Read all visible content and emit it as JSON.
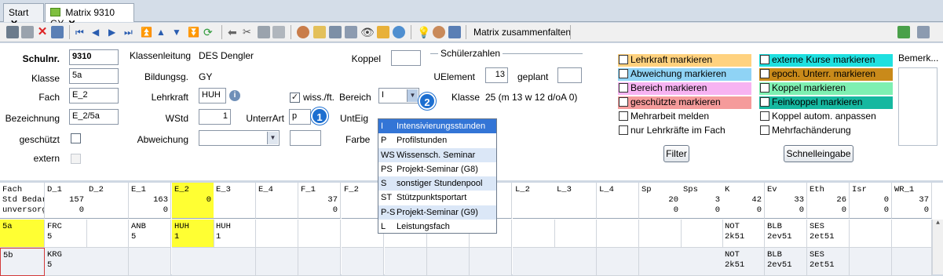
{
  "tabs": [
    {
      "label": "Start",
      "close": "✕"
    },
    {
      "label": "Matrix 9310 GY",
      "close": "✕"
    }
  ],
  "toolbar": {
    "collapse_label": "Matrix zusammenfalten"
  },
  "form": {
    "schulnr_label": "Schulnr.",
    "schulnr_value": "9310",
    "klasse_label": "Klasse",
    "klasse_value": "5a",
    "fach_label": "Fach",
    "fach_value": "E_2",
    "bezeichnung_label": "Bezeichnung",
    "bezeichnung_value": "E_2/5a",
    "geschuetzt_label": "geschützt",
    "extern_label": "extern",
    "klassenleitung_label": "Klassenleitung",
    "klassenleitung_value": "DES Dengler",
    "bildungsg_label": "Bildungsg.",
    "bildungsg_value": "GY",
    "lehrkraft_label": "Lehrkraft",
    "lehrkraft_value": "HUH",
    "wstd_label": "WStd",
    "wstd_value": "1",
    "abweichung_label": "Abweichung",
    "abweichung_value": "",
    "koppel_label": "Koppel",
    "koppel_value": "",
    "wiss_label": "wiss./ft.",
    "bereich_label": "Bereich",
    "bereich_value": "I",
    "unterrart_label": "UnterrArt",
    "unterrart_value": "p",
    "unteig_label": "UntEig",
    "farbe_label": "Farbe",
    "schuelerzahlen_label": "Schülerzahlen",
    "uelement_label": "UElement",
    "uelement_value": "13",
    "geplant_label": "geplant",
    "geplant_value": "",
    "klasse2_label": "Klasse",
    "klasse2_value": "25 (m 13 w 12 d/oA 0)",
    "bemerk_label": "Bemerk..."
  },
  "markers_left": [
    {
      "label": "Lehrkraft markieren",
      "color": "#ffd27f"
    },
    {
      "label": "Abweichung markieren",
      "color": "#8fd3f5"
    },
    {
      "label": "Bereich markieren",
      "color": "#f7b3f2"
    },
    {
      "label": "geschützte markieren",
      "color": "#f59b9b"
    },
    {
      "label": "Mehrarbeit melden",
      "color": ""
    },
    {
      "label": "nur Lehrkräfte im Fach",
      "color": ""
    }
  ],
  "markers_right": [
    {
      "label": "externe Kurse markieren",
      "color": "#1fe0e0"
    },
    {
      "label": "epoch. Unterr. markieren",
      "color": "#c98a1a"
    },
    {
      "label": "Koppel markieren",
      "color": "#7ef0b2"
    },
    {
      "label": "Feinkoppel markieren",
      "color": "#16b8a0"
    },
    {
      "label": "Koppel autom. anpassen",
      "color": ""
    },
    {
      "label": "Mehrfachänderung",
      "color": ""
    }
  ],
  "buttons": {
    "filter": "Filter",
    "schnelleingabe": "Schnelleingabe"
  },
  "badges": {
    "one": "1",
    "two": "2"
  },
  "dropdown": {
    "items": [
      {
        "code": "I",
        "label": "Intensivierungsstunden"
      },
      {
        "code": "P",
        "label": "Profilstunden"
      },
      {
        "code": "WS",
        "label": "Wissensch. Seminar"
      },
      {
        "code": "PS",
        "label": "Projekt-Seminar (G8)"
      },
      {
        "code": "S",
        "label": "sonstiger Stundenpool"
      },
      {
        "code": "ST",
        "label": "Stützpunktsportart"
      },
      {
        "code": "P-S",
        "label": "Projekt-Seminar (G9)"
      },
      {
        "code": "L",
        "label": "Leistungsfach"
      }
    ]
  },
  "grid": {
    "corner": [
      "Fach",
      "Std Bedarf",
      "unversorgt"
    ],
    "columns": [
      {
        "name": "D_1",
        "bedarf": "157",
        "unv": "0"
      },
      {
        "name": "D_2",
        "bedarf": "",
        "unv": ""
      },
      {
        "name": "E_1",
        "bedarf": "163",
        "unv": "0"
      },
      {
        "name": "E_2",
        "bedarf": "",
        "unv": "0"
      },
      {
        "name": "E_3",
        "bedarf": "",
        "unv": ""
      },
      {
        "name": "E_4",
        "bedarf": "",
        "unv": ""
      },
      {
        "name": "F_1",
        "bedarf": "37",
        "unv": "0"
      },
      {
        "name": "F_2",
        "bedarf": "",
        "unv": ""
      },
      {
        "name": "",
        "bedarf": "",
        "unv": ""
      },
      {
        "name": "",
        "bedarf": "",
        "unv": ""
      },
      {
        "name": "",
        "bedarf": "",
        "unv": ""
      },
      {
        "name": "L_2",
        "bedarf": "",
        "unv": ""
      },
      {
        "name": "L_3",
        "bedarf": "",
        "unv": ""
      },
      {
        "name": "L_4",
        "bedarf": "",
        "unv": ""
      },
      {
        "name": "Sp",
        "bedarf": "20",
        "unv": "0"
      },
      {
        "name": "Sps",
        "bedarf": "3",
        "unv": "0"
      },
      {
        "name": "K",
        "bedarf": "42",
        "unv": "0"
      },
      {
        "name": "Ev",
        "bedarf": "33",
        "unv": "0"
      },
      {
        "name": "Eth",
        "bedarf": "26",
        "unv": "0"
      },
      {
        "name": "Isr",
        "bedarf": "0",
        "unv": "0"
      },
      {
        "name": "WR_1",
        "bedarf": "37",
        "unv": "0"
      }
    ],
    "rows": [
      {
        "klasse": "5a",
        "cells": [
          [
            "FRC",
            "5"
          ],
          [
            "",
            ""
          ],
          [
            "ANB",
            "5"
          ],
          [
            "HUH",
            "1"
          ],
          [
            "HUH",
            "1"
          ],
          [
            "",
            ""
          ],
          [
            "",
            ""
          ],
          [
            "",
            ""
          ],
          [
            "",
            ""
          ],
          [
            "",
            ""
          ],
          [
            "",
            ""
          ],
          [
            "",
            ""
          ],
          [
            "",
            ""
          ],
          [
            "",
            ""
          ],
          [
            "",
            ""
          ],
          [
            "",
            ""
          ],
          [
            "NOT",
            "2k51"
          ],
          [
            "BLB",
            "2ev51"
          ],
          [
            "SES",
            "2et51"
          ],
          [
            "",
            ""
          ],
          [
            "",
            ""
          ]
        ]
      },
      {
        "klasse": "5b",
        "cells": [
          [
            "KRG",
            "5"
          ],
          [
            "",
            ""
          ],
          [
            "",
            ""
          ],
          [
            "",
            ""
          ],
          [
            "",
            ""
          ],
          [
            "",
            ""
          ],
          [
            "",
            ""
          ],
          [
            "",
            ""
          ],
          [
            "",
            ""
          ],
          [
            "",
            ""
          ],
          [
            "",
            ""
          ],
          [
            "",
            ""
          ],
          [
            "",
            ""
          ],
          [
            "",
            ""
          ],
          [
            "",
            ""
          ],
          [
            "",
            ""
          ],
          [
            "NOT",
            "2k51"
          ],
          [
            "BLB",
            "2ev51"
          ],
          [
            "SES",
            "2et51"
          ],
          [
            "",
            ""
          ],
          [
            "",
            ""
          ]
        ]
      }
    ]
  }
}
